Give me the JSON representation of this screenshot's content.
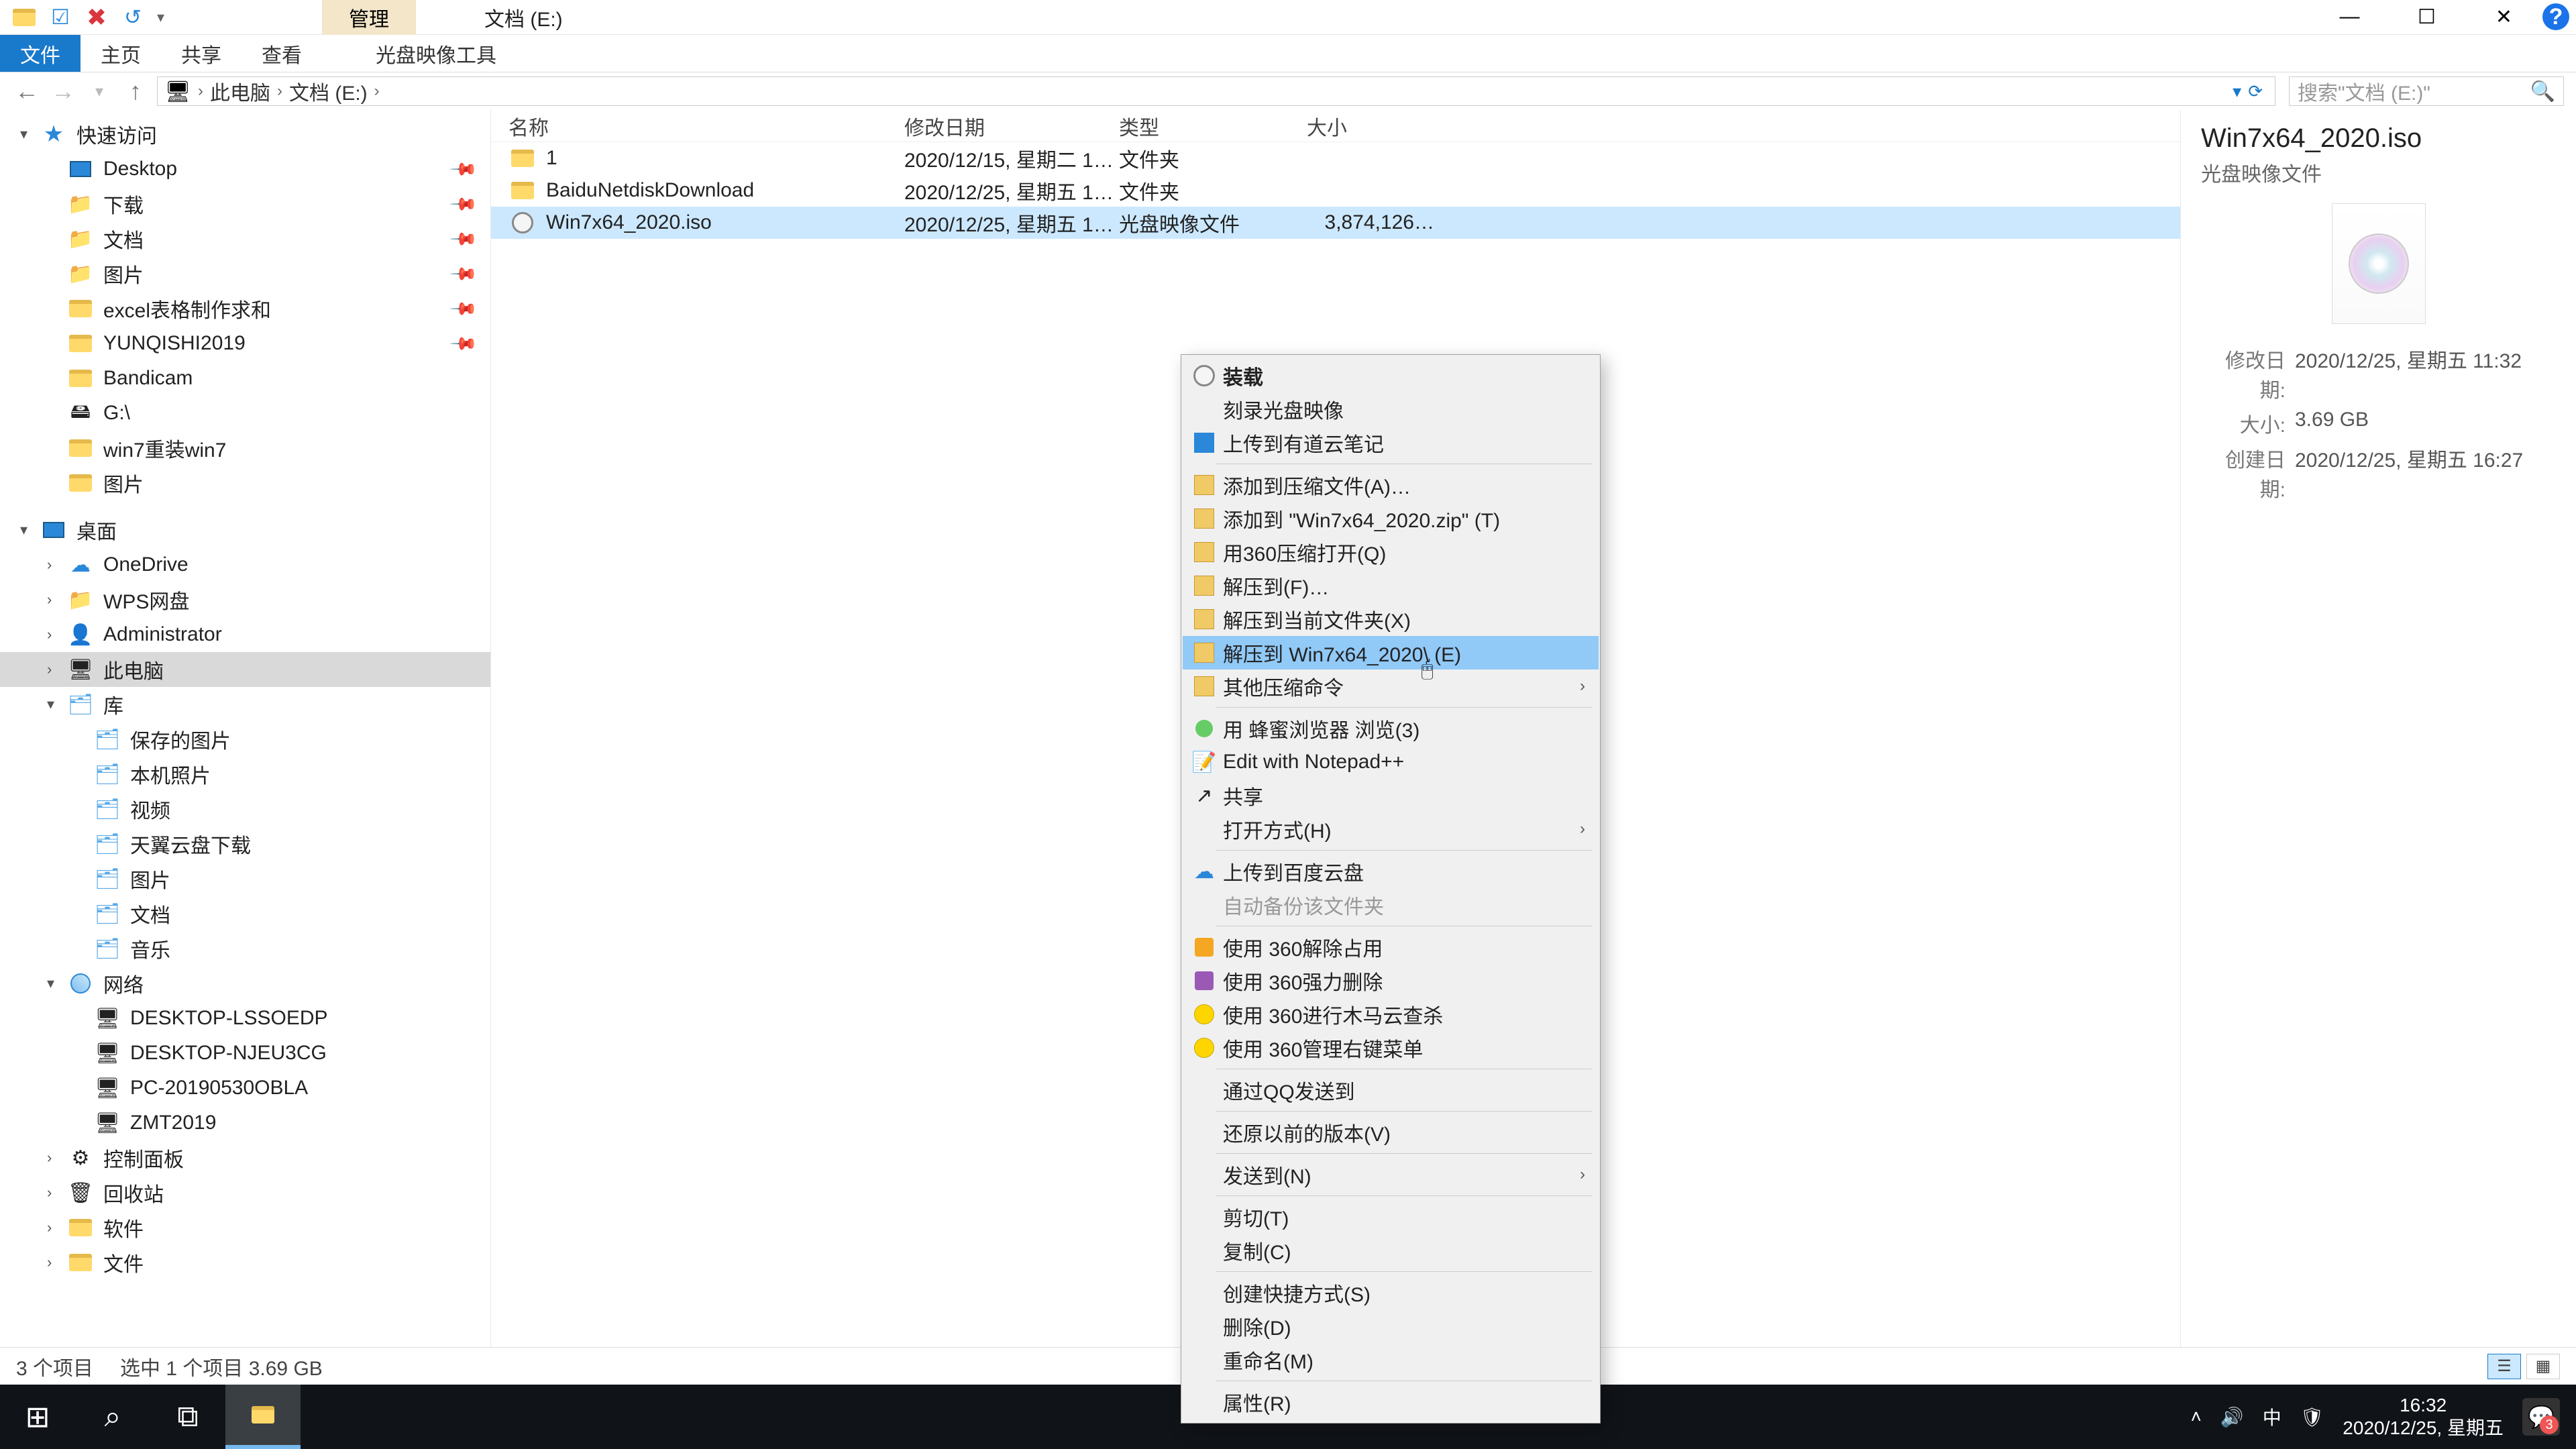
{
  "window": {
    "tab": "管理",
    "title": "文档 (E:)"
  },
  "ribbon": {
    "file": "文件",
    "tabs": [
      "主页",
      "共享",
      "查看"
    ],
    "tool": "光盘映像工具"
  },
  "nav": {
    "back": "←",
    "forward": "→",
    "up": "↑"
  },
  "breadcrumb": [
    "此电脑",
    "文档 (E:)"
  ],
  "search": {
    "placeholder": "搜索\"文档 (E:)\""
  },
  "tree": {
    "quick": {
      "label": "快速访问",
      "items": [
        {
          "label": "Desktop",
          "pin": true,
          "icon": "desktop"
        },
        {
          "label": "下载",
          "pin": true,
          "icon": "folder-blue"
        },
        {
          "label": "文档",
          "pin": true,
          "icon": "folder-blue"
        },
        {
          "label": "图片",
          "pin": true,
          "icon": "folder-blue"
        },
        {
          "label": "excel表格制作求和",
          "pin": true,
          "icon": "folder"
        },
        {
          "label": "YUNQISHI2019",
          "pin": true,
          "icon": "folder"
        },
        {
          "label": "Bandicam",
          "pin": false,
          "icon": "folder"
        },
        {
          "label": "G:\\",
          "pin": false,
          "icon": "drive"
        },
        {
          "label": "win7重装win7",
          "pin": false,
          "icon": "folder"
        },
        {
          "label": "图片",
          "pin": false,
          "icon": "folder"
        }
      ]
    },
    "desktop": {
      "label": "桌面",
      "children": [
        {
          "label": "OneDrive",
          "icon": "cloud"
        },
        {
          "label": "WPS网盘",
          "icon": "folder-blue"
        },
        {
          "label": "Administrator",
          "icon": "user"
        },
        {
          "label": "此电脑",
          "icon": "pc",
          "selected": true
        },
        {
          "label": "库",
          "icon": "library",
          "children": [
            {
              "label": "保存的图片"
            },
            {
              "label": "本机照片"
            },
            {
              "label": "视频"
            },
            {
              "label": "天翼云盘下载"
            },
            {
              "label": "图片"
            },
            {
              "label": "文档"
            },
            {
              "label": "音乐"
            }
          ]
        },
        {
          "label": "网络",
          "icon": "network",
          "children": [
            {
              "label": "DESKTOP-LSSOEDP"
            },
            {
              "label": "DESKTOP-NJEU3CG"
            },
            {
              "label": "PC-20190530OBLA"
            },
            {
              "label": "ZMT2019"
            }
          ]
        },
        {
          "label": "控制面板",
          "icon": "control"
        },
        {
          "label": "回收站",
          "icon": "recycle"
        },
        {
          "label": "软件",
          "icon": "folder"
        },
        {
          "label": "文件",
          "icon": "folder"
        }
      ]
    }
  },
  "columns": {
    "name": "名称",
    "date": "修改日期",
    "type": "类型",
    "size": "大小"
  },
  "rows": [
    {
      "name": "1",
      "date": "2020/12/15, 星期二 1…",
      "type": "文件夹",
      "size": "",
      "icon": "folder"
    },
    {
      "name": "BaiduNetdiskDownload",
      "date": "2020/12/25, 星期五 1…",
      "type": "文件夹",
      "size": "",
      "icon": "folder"
    },
    {
      "name": "Win7x64_2020.iso",
      "date": "2020/12/25, 星期五 1…",
      "type": "光盘映像文件",
      "size": "3,874,126…",
      "icon": "iso",
      "selected": true
    }
  ],
  "context": {
    "groups": [
      [
        {
          "label": "装载",
          "bold": true,
          "icon": "disc"
        },
        {
          "label": "刻录光盘映像"
        },
        {
          "label": "上传到有道云笔记",
          "icon": "blue"
        }
      ],
      [
        {
          "label": "添加到压缩文件(A)…",
          "icon": "archive"
        },
        {
          "label": "添加到 \"Win7x64_2020.zip\" (T)",
          "icon": "archive"
        },
        {
          "label": "用360压缩打开(Q)",
          "icon": "archive"
        },
        {
          "label": "解压到(F)…",
          "icon": "archive"
        },
        {
          "label": "解压到当前文件夹(X)",
          "icon": "archive"
        },
        {
          "label": "解压到 Win7x64_2020\\ (E)",
          "icon": "archive",
          "hover": true
        },
        {
          "label": "其他压缩命令",
          "icon": "archive",
          "submenu": true
        }
      ],
      [
        {
          "label": "用 蜂蜜浏览器 浏览(3)",
          "icon": "green-dot"
        },
        {
          "label": "Edit with Notepad++",
          "icon": "npp"
        },
        {
          "label": "共享",
          "icon": "share"
        },
        {
          "label": "打开方式(H)",
          "submenu": true
        }
      ],
      [
        {
          "label": "上传到百度云盘",
          "icon": "cloud-blue"
        },
        {
          "label": "自动备份该文件夹",
          "disabled": true
        }
      ],
      [
        {
          "label": "使用 360解除占用",
          "icon": "360-orange"
        },
        {
          "label": "使用 360强力删除",
          "icon": "360-purple"
        },
        {
          "label": "使用 360进行木马云查杀",
          "icon": "360-yellow"
        },
        {
          "label": "使用 360管理右键菜单",
          "icon": "360-yellow"
        }
      ],
      [
        {
          "label": "通过QQ发送到"
        }
      ],
      [
        {
          "label": "还原以前的版本(V)"
        }
      ],
      [
        {
          "label": "发送到(N)",
          "submenu": true
        }
      ],
      [
        {
          "label": "剪切(T)"
        },
        {
          "label": "复制(C)"
        }
      ],
      [
        {
          "label": "创建快捷方式(S)"
        },
        {
          "label": "删除(D)"
        },
        {
          "label": "重命名(M)"
        }
      ],
      [
        {
          "label": "属性(R)"
        }
      ]
    ]
  },
  "preview": {
    "title": "Win7x64_2020.iso",
    "subtitle": "光盘映像文件",
    "rows": [
      {
        "label": "修改日期:",
        "value": "2020/12/25, 星期五 11:32"
      },
      {
        "label": "大小:",
        "value": "3.69 GB"
      },
      {
        "label": "创建日期:",
        "value": "2020/12/25, 星期五 16:27"
      }
    ]
  },
  "status": {
    "count": "3 个项目",
    "selection": "选中 1 个项目  3.69 GB"
  },
  "taskbar": {
    "tray": {
      "ime": "中",
      "time": "16:32",
      "date": "2020/12/25, 星期五",
      "notif_count": "3"
    }
  }
}
